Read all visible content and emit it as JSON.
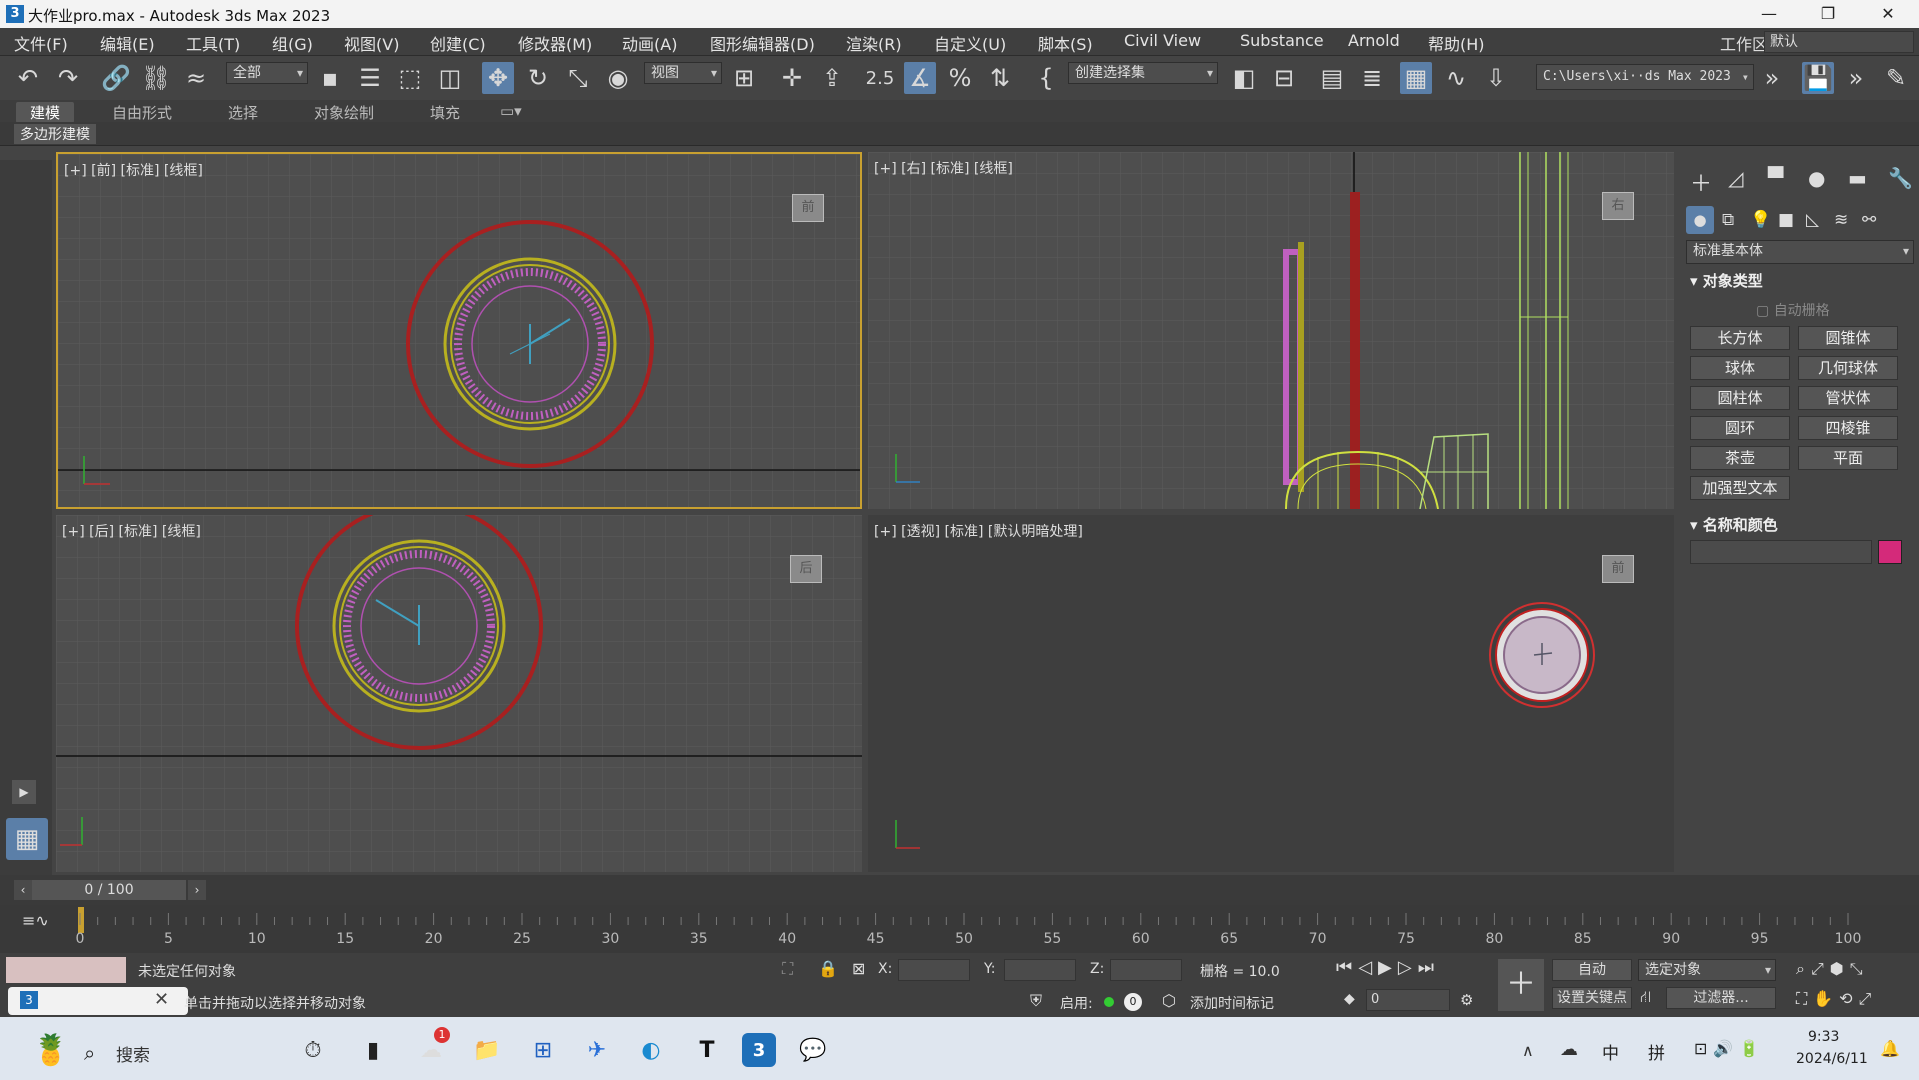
{
  "window": {
    "title": "大作业pro.max - Autodesk 3ds Max 2023",
    "minimize": "—",
    "maximize": "❐",
    "close": "✕"
  },
  "menu": [
    "文件(F)",
    "编辑(E)",
    "工具(T)",
    "组(G)",
    "视图(V)",
    "创建(C)",
    "修改器(M)",
    "动画(A)",
    "图形编辑器(D)",
    "渲染(R)",
    "自定义(U)",
    "脚本(S)",
    "Civil View",
    "Substance",
    "Arnold",
    "帮助(H)"
  ],
  "workspace": {
    "label": "工作区:",
    "value": "默认"
  },
  "toolbar": {
    "selection_filter": "全部",
    "ref_coord": "视图",
    "named_sel": "创建选择集",
    "path": "C:\\Users\\xi··ds Max 2023",
    "snap_value": "2.5"
  },
  "ribbon": {
    "tabs": [
      "建模",
      "自由形式",
      "选择",
      "对象绘制",
      "填充"
    ],
    "active": "建模",
    "sub": "多边形建模"
  },
  "viewports": {
    "front": {
      "label": "[+] [前] [标准] [线框]",
      "cube": "前"
    },
    "right": {
      "label": "[+] [右] [标准] [线框]",
      "cube": "右"
    },
    "back": {
      "label": "[+] [后] [标准] [线框]",
      "cube": "后"
    },
    "persp": {
      "label": "[+] [透视] [标准] [默认明暗处理]",
      "cube": "前"
    }
  },
  "command_panel": {
    "category": "标准基本体",
    "object_type": "对象类型",
    "autogrid": "自动栅格",
    "buttons": [
      "长方体",
      "圆锥体",
      "球体",
      "几何球体",
      "圆柱体",
      "管状体",
      "圆环",
      "四棱锥",
      "茶壶",
      "平面",
      "加强型文本"
    ],
    "name_color": "名称和颜色",
    "swatch": "#d42a7a"
  },
  "timeline": {
    "frame": "0 / 100",
    "ticks": [
      "0",
      "5",
      "10",
      "15",
      "20",
      "25",
      "30",
      "35",
      "40",
      "45",
      "50",
      "55",
      "60",
      "65",
      "70",
      "75",
      "80",
      "85",
      "90",
      "95",
      "100"
    ]
  },
  "status": {
    "msg1": "未选定任何对象",
    "msg2": "单击并拖动以选择并移动对象",
    "x": "X:",
    "y": "Y:",
    "z": "Z:",
    "grid": "栅格 = 10.0",
    "enable": "启用:",
    "add_time_tag": "添加时间标记",
    "auto": "自动",
    "selected": "选定对象",
    "set_key": "设置关键点",
    "filter": "过滤器...",
    "frame_field": "0"
  },
  "taskbar": {
    "search": "搜索",
    "ime1": "中",
    "ime2": "拼",
    "time": "9:33",
    "date": "2024/6/11",
    "badge": "1"
  }
}
